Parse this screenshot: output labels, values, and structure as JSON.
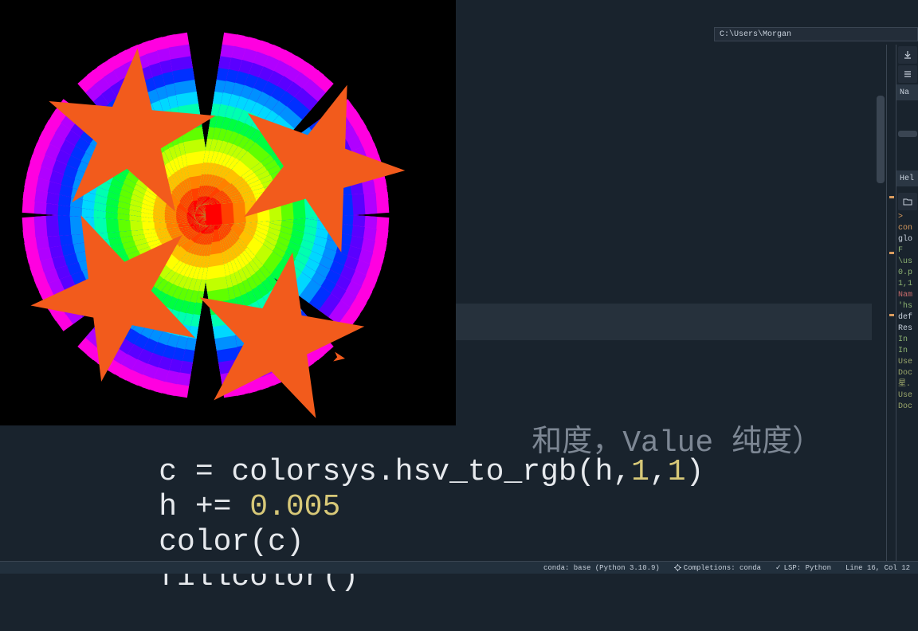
{
  "path": "C:\\Users\\Morgan",
  "right_panel": {
    "name_header": "Na",
    "lines": [
      {
        "cls": "rp-orange",
        "t": ">"
      },
      {
        "cls": "rp-orange",
        "t": "con"
      },
      {
        "cls": "",
        "t": ""
      },
      {
        "cls": "",
        "t": "glo"
      },
      {
        "cls": "",
        "t": ""
      },
      {
        "cls": "rp-green",
        "t": "   F"
      },
      {
        "cls": "rp-green",
        "t": "\\us"
      },
      {
        "cls": "rp-green",
        "t": "0.p"
      },
      {
        "cls": "",
        "t": ""
      },
      {
        "cls": "rp-green",
        "t": "1,1"
      },
      {
        "cls": "",
        "t": ""
      },
      {
        "cls": "rp-red",
        "t": "Nam"
      },
      {
        "cls": "rp-green",
        "t": "'hs"
      },
      {
        "cls": "",
        "t": "def"
      },
      {
        "cls": "",
        "t": ""
      },
      {
        "cls": "",
        "t": ""
      },
      {
        "cls": "",
        "t": "Res"
      },
      {
        "cls": "",
        "t": ""
      },
      {
        "cls": "rp-green",
        "t": "In"
      },
      {
        "cls": "",
        "t": ""
      },
      {
        "cls": "",
        "t": ""
      },
      {
        "cls": "rp-green",
        "t": "In"
      },
      {
        "cls": "rp-olive",
        "t": "Use"
      },
      {
        "cls": "rp-olive",
        "t": "Doc"
      },
      {
        "cls": "rp-olive",
        "t": "星."
      },
      {
        "cls": "rp-olive",
        "t": "Use"
      },
      {
        "cls": "rp-olive",
        "t": "Doc"
      }
    ],
    "help_label": "Hel"
  },
  "code": {
    "line_comment": "和度，Value 纯度）",
    "line1_a": "c = colorsys.hsv_to_rgb(h,",
    "line1_b": "1",
    "line1_c": ",",
    "line1_d": "1",
    "line1_e": ")",
    "line2_a": "h += ",
    "line2_b": "0.005",
    "line3": "color(c)",
    "line4": "fillcolor()"
  },
  "status": {
    "conda": "conda: base (Python 3.10.9)",
    "completions": "Completions: conda",
    "lsp": "LSP: Python",
    "cursor": "Line 16, Col 12"
  },
  "icons": {
    "download": "download-icon",
    "hamburger": "hamburger-icon",
    "folder": "folder-icon"
  }
}
